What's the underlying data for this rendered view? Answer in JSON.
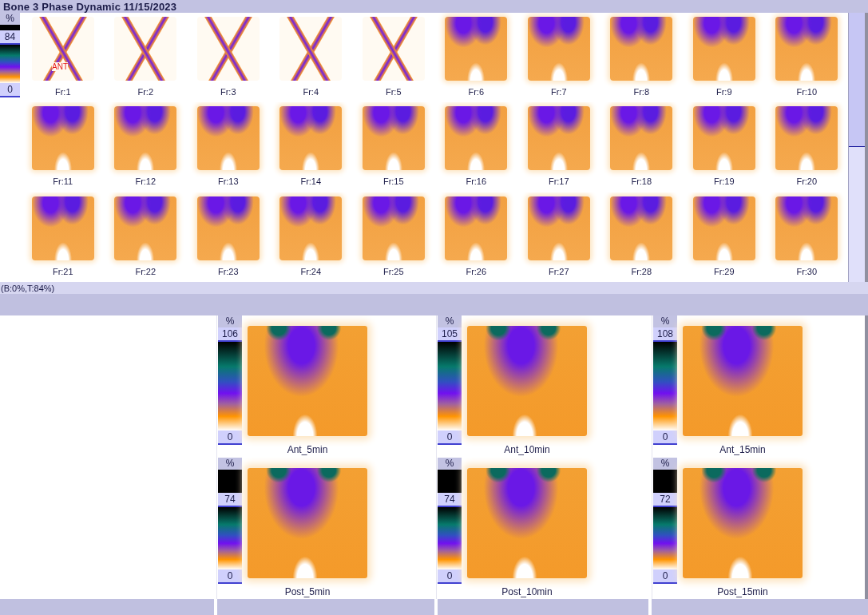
{
  "window": {
    "title": "Bone 3 Phase Dynamic 11/15/2023"
  },
  "dynamic": {
    "scale": {
      "unit": "%",
      "clipped": true,
      "max": "84",
      "min": "0"
    },
    "orientation": "ANT",
    "frames": [
      "Fr:1",
      "Fr:2",
      "Fr:3",
      "Fr:4",
      "Fr:5",
      "Fr:6",
      "Fr:7",
      "Fr:8",
      "Fr:9",
      "Fr:10",
      "Fr:11",
      "Fr:12",
      "Fr:13",
      "Fr:14",
      "Fr:15",
      "Fr:16",
      "Fr:17",
      "Fr:18",
      "Fr:19",
      "Fr:20",
      "Fr:21",
      "Fr:22",
      "Fr:23",
      "Fr:24",
      "Fr:25",
      "Fr:26",
      "Fr:27",
      "Fr:28",
      "Fr:29",
      "Fr:30"
    ]
  },
  "status_bar": "(B:0%,T:84%)",
  "static_views": [
    {
      "label": "Ant_5min",
      "scale": {
        "unit": "%",
        "clipped": false,
        "max": "106",
        "min": "0"
      }
    },
    {
      "label": "Ant_10min",
      "scale": {
        "unit": "%",
        "clipped": false,
        "max": "105",
        "min": "0"
      }
    },
    {
      "label": "Ant_15min",
      "scale": {
        "unit": "%",
        "clipped": false,
        "max": "108",
        "min": "0"
      }
    },
    {
      "label": "Post_5min",
      "scale": {
        "unit": "%",
        "clipped": true,
        "max": "74",
        "min": "0"
      }
    },
    {
      "label": "Post_10min",
      "scale": {
        "unit": "%",
        "clipped": true,
        "max": "74",
        "min": "0"
      }
    },
    {
      "label": "Post_15min",
      "scale": {
        "unit": "%",
        "clipped": true,
        "max": "72",
        "min": "0"
      }
    }
  ]
}
